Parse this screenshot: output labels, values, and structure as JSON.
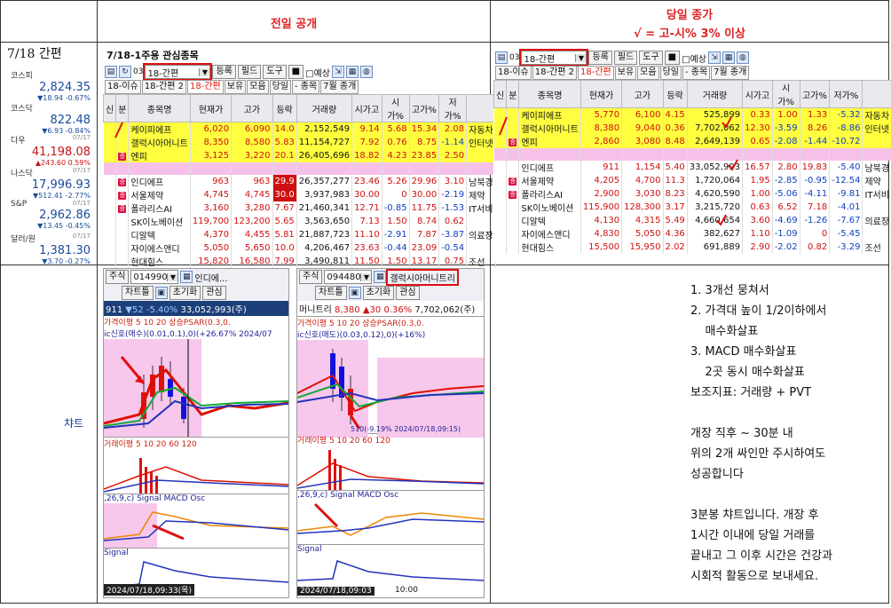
{
  "header": {
    "prev_day": "전일 공개",
    "today_close": "당일 종가",
    "condition": "√ = 고-시% 3% 이상"
  },
  "date_label": "7/18 간편",
  "indices": [
    {
      "name": "코스피",
      "value": "2,824.35",
      "change": "▼18.94 -0.67%",
      "up": false,
      "date": ""
    },
    {
      "name": "코스닥",
      "value": "822.48",
      "change": "▼6.93 -0.84%",
      "up": false,
      "date": ""
    },
    {
      "name": "다우",
      "value": "41,198.08",
      "change": "▲243.60 0.59%",
      "up": true,
      "date": "07/17"
    },
    {
      "name": "나스닥",
      "value": "17,996.93",
      "change": "▼512.41 -2.77%",
      "up": false,
      "date": "07/17"
    },
    {
      "name": "S&P",
      "value": "2,962.86",
      "change": "▼13.45 -0.45%",
      "up": false,
      "date": "07/17"
    },
    {
      "name": "달러/원",
      "value": "1,381.30",
      "change": "▼3.70 -0.27%",
      "up": false,
      "date": "07/17"
    }
  ],
  "left_window": {
    "title": "7/18-1주용 관심종목",
    "combo_value": "18-간편",
    "combo_prefix": "03",
    "buttons": [
      "등록",
      "필드",
      "도구",
      "■",
      "□예상"
    ],
    "tabs": [
      "18-이슈",
      "18-간편 2",
      "18-간편",
      "보유",
      "모음",
      "당일",
      "- 종목",
      "7월 종개"
    ],
    "columns": [
      "신",
      "분",
      "종목명",
      "현재가",
      "고가",
      "등락",
      "거래량",
      "시가고",
      "시가%",
      "고가%",
      "저가%",
      ""
    ],
    "rows": [
      {
        "style": "yel",
        "tag": "",
        "name": "케이피에프",
        "cur": "6,020",
        "high": "6,090",
        "chg": "14.0",
        "vol": "2,152,549",
        "c1": "9.14",
        "c2": "5.68",
        "c3": "15.34",
        "c4": "2.08",
        "sector": "자동차"
      },
      {
        "style": "yel",
        "tag": "",
        "name": "갤럭시아머니트",
        "cur": "8,350",
        "high": "8,580",
        "chg": "5.83",
        "vol": "11,154,727",
        "c1": "7.92",
        "c2": "0.76",
        "c3": "8.75",
        "c4": "-1.14",
        "sector": "인터넷"
      },
      {
        "style": "yel",
        "tag": "증",
        "name": "엔피",
        "cur": "3,125",
        "high": "3,220",
        "chg": "20.1",
        "vol": "26,405,696",
        "c1": "18.82",
        "c2": "4.23",
        "c3": "23.85",
        "c4": "2.50",
        "sector": ""
      },
      {
        "style": "pink",
        "tag": "",
        "name": "",
        "cur": "",
        "high": "",
        "chg": "",
        "vol": "",
        "c1": "",
        "c2": "",
        "c3": "",
        "c4": "",
        "sector": ""
      },
      {
        "style": "",
        "tag": "증",
        "name": "인디에프",
        "cur": "963",
        "high": "963",
        "chg": "29.9",
        "vol": "26,357,277",
        "c1": "23.46",
        "c2": "5.26",
        "c3": "29.96",
        "c4": "3.10",
        "sector": "남북경"
      },
      {
        "style": "",
        "tag": "증",
        "name": "서울제약",
        "cur": "4,745",
        "high": "4,745",
        "chg": "30.0",
        "vol": "3,937,983",
        "c1": "30.00",
        "c2": "0",
        "c3": "30.00",
        "c4": "-2.19",
        "sector": "제약"
      },
      {
        "style": "",
        "tag": "증",
        "name": "폴라리스AI",
        "cur": "3,160",
        "high": "3,280",
        "chg": "7.67",
        "vol": "21,460,341",
        "c1": "12.71",
        "c2": "-0.85",
        "c3": "11.75",
        "c4": "-1.53",
        "sector": "IT서비"
      },
      {
        "style": "",
        "tag": "",
        "name": "SK이노베이션",
        "cur": "119,700",
        "high": "123,200",
        "chg": "5.65",
        "vol": "3,563,650",
        "c1": "7.13",
        "c2": "1.50",
        "c3": "8.74",
        "c4": "0.62",
        "sector": ""
      },
      {
        "style": "",
        "tag": "",
        "name": "디알텍",
        "cur": "4,370",
        "high": "4,455",
        "chg": "5.81",
        "vol": "21,887,723",
        "c1": "11.10",
        "c2": "-2.91",
        "c3": "7.87",
        "c4": "-3.87",
        "sector": "의료장"
      },
      {
        "style": "",
        "tag": "",
        "name": "자이에스앤디",
        "cur": "5,050",
        "high": "5,650",
        "chg": "10.0",
        "vol": "4,206,467",
        "c1": "23.63",
        "c2": "-0.44",
        "c3": "23.09",
        "c4": "-0.54",
        "sector": ""
      },
      {
        "style": "",
        "tag": "",
        "name": "현대힘스",
        "cur": "15,820",
        "high": "16,580",
        "chg": "7.99",
        "vol": "3,490,811",
        "c1": "11.50",
        "c2": "1.50",
        "c3": "13.17",
        "c4": "0.75",
        "sector": "조선"
      }
    ]
  },
  "right_window": {
    "combo_value": "18-간편",
    "combo_prefix": "03",
    "buttons": [
      "등록",
      "필드",
      "도구",
      "■",
      "□예상"
    ],
    "tabs": [
      "18-이슈",
      "18-간편 2",
      "18-간편",
      "보유",
      "모음",
      "당일",
      "- 종목",
      "7월 종개"
    ],
    "columns": [
      "신",
      "분",
      "종목명",
      "현재가",
      "고가",
      "등락",
      "거래량",
      "시가고",
      "시가%",
      "고가%",
      "저가%",
      ""
    ],
    "rows": [
      {
        "style": "yel",
        "tag": "",
        "name": "케이피에프",
        "cur": "5,770",
        "high": "6,100",
        "chg": "4.15",
        "vol": "525,899",
        "c1": "0.33",
        "c2": "1.00",
        "c3": "1.33",
        "c4": "-5.32",
        "sector": "자동차"
      },
      {
        "style": "yel",
        "tag": "",
        "name": "갤럭시아머니트",
        "cur": "8,380",
        "high": "9,040",
        "chg": "0.36",
        "vol": "7,702,062",
        "c1": "12.30",
        "c2": "-3.59",
        "c3": "8.26",
        "c4": "-8.86",
        "sector": "인터넷"
      },
      {
        "style": "yel",
        "tag": "증",
        "name": "엔피",
        "cur": "2,860",
        "high": "3,080",
        "chg": "8.48",
        "vol": "2,649,139",
        "c1": "0.65",
        "c2": "-2.08",
        "c3": "-1.44",
        "c4": "-10.72",
        "sector": ""
      },
      {
        "style": "pink",
        "tag": "",
        "name": "",
        "cur": "",
        "high": "",
        "chg": "",
        "vol": "",
        "c1": "",
        "c2": "",
        "c3": "",
        "c4": "",
        "sector": ""
      },
      {
        "style": "",
        "tag": "",
        "name": "인디에프",
        "cur": "911",
        "high": "1,154",
        "chg": "5.40",
        "vol": "33,052,993",
        "c1": "16.57",
        "c2": "2.80",
        "c3": "19.83",
        "c4": "-5.40",
        "sector": "남북경"
      },
      {
        "style": "",
        "tag": "증",
        "name": "서울제약",
        "cur": "4,205",
        "high": "4,700",
        "chg": "11.3",
        "vol": "1,720,064",
        "c1": "1.95",
        "c2": "-2.85",
        "c3": "-0.95",
        "c4": "-12.54",
        "sector": "제약"
      },
      {
        "style": "",
        "tag": "증",
        "name": "폴라리스AI",
        "cur": "2,900",
        "high": "3,030",
        "chg": "8.23",
        "vol": "4,620,590",
        "c1": "1.00",
        "c2": "-5.06",
        "c3": "-4.11",
        "c4": "-9.81",
        "sector": "IT서비"
      },
      {
        "style": "",
        "tag": "",
        "name": "SK이노베이션",
        "cur": "115,900",
        "high": "128,300",
        "chg": "3.17",
        "vol": "3,215,720",
        "c1": "0.63",
        "c2": "6.52",
        "c3": "7.18",
        "c4": "-4.01",
        "sector": ""
      },
      {
        "style": "",
        "tag": "",
        "name": "디알텍",
        "cur": "4,130",
        "high": "4,315",
        "chg": "5.49",
        "vol": "4,660,654",
        "c1": "3.60",
        "c2": "-4.69",
        "c3": "-1.26",
        "c4": "-7.67",
        "sector": "의료장"
      },
      {
        "style": "",
        "tag": "",
        "name": "자이에스앤디",
        "cur": "4,830",
        "high": "5,050",
        "chg": "4.36",
        "vol": "382,627",
        "c1": "1.10",
        "c2": "-1.09",
        "c3": "0",
        "c4": "-5.45",
        "sector": ""
      },
      {
        "style": "",
        "tag": "",
        "name": "현대힘스",
        "cur": "15,500",
        "high": "15,950",
        "chg": "2.02",
        "vol": "691,889",
        "c1": "2.90",
        "c2": "-2.02",
        "c3": "0.82",
        "c4": "-3.29",
        "sector": "조선"
      }
    ]
  },
  "chart_label": "챠트",
  "chart1": {
    "market": "주식",
    "code": "014990",
    "name": "인디에...",
    "btn_chart": "차트틀",
    "btn_init": "초기화",
    "btn_watch": "관심",
    "price": "911",
    "change": "▼52",
    "pct": "-5.40%",
    "volume": "33,052,993(주)",
    "ma_legend": "가격이평 5 10 20",
    "psar": "상승PSAR(0.3,0.",
    "signal_text": "ic신호(매수)(0.01,0.1),0)(+26.67% 2024/07",
    "vol_legend": "거래이평 5 10 20 60 120",
    "macd_legend": ",26,9,c) Signal MACD Osc",
    "signal2": "Signal",
    "time": "2024/07/18,09:33(목)"
  },
  "chart2": {
    "market": "주식",
    "code": "094480",
    "name": "갤럭시아머니트리",
    "btn_chart": "차트틀",
    "btn_init": "초기화",
    "btn_watch": "관심",
    "price": "8,380",
    "change": "▲30",
    "pct": "0.36%",
    "volume": "7,702,062(주)",
    "head": "머니트리",
    "ma_legend": "가격이평 5 10 20",
    "psar": "상승PSAR(0.3,0.",
    "signal_text": "ic신호(매도)(0.03,0.12),0)(+16%)",
    "note": "510(-9.19% 2024/07/18,09:15)",
    "vol_legend": "거래이평 5 10 20 60 120",
    "macd_legend": ",26,9,c) Signal MACD Osc",
    "signal2": "Signal",
    "time": "2024/07/18,09:03",
    "time2": "10:00"
  },
  "notes": [
    "1. 3개선 뭉쳐서",
    "2. 가격대 높이 1/2이하에서",
    "    매수화살표",
    "3. MACD 매수화살표",
    "    2곳 동시 매수화살표",
    "보조지표: 거래량 + PVT",
    "",
    "개장 직후 ~ 30분 내",
    "위의 2개 싸인만 주시하여도",
    "성공합니다",
    "",
    "3분봉 챠트입니다. 개장 후",
    "1시간 이내에 당일 거래를",
    "끝내고 그 이후 시간은 건강과",
    "시회적 활동으로 보내세요."
  ]
}
